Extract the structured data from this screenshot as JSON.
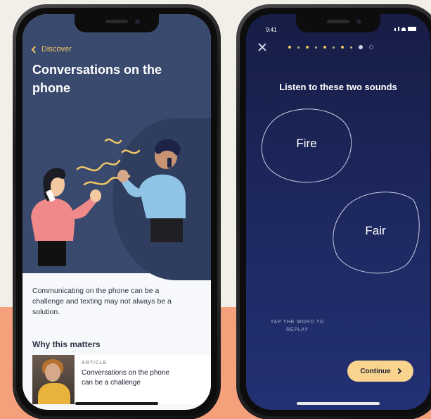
{
  "colors": {
    "accent": "#f2c665",
    "hero_bg": "#3a4a6e",
    "lesson_bg": "#1e2a63",
    "cta": "#f9d48f",
    "backdrop_bottom": "#f4a07a"
  },
  "left_screen": {
    "back_label": "Discover",
    "title": "Conversations on the phone",
    "intro": "Communicating on the phone can be a challenge and texting may not always be a solution.",
    "section_heading": "Why this matters",
    "article": {
      "label": "ARTICLE",
      "title": "Conversations on the phone can be a challenge"
    }
  },
  "right_screen": {
    "status_time": "9:41",
    "prompt": "Listen to these two sounds",
    "words": [
      "Fire",
      "Fair"
    ],
    "hint": "TAP THE WORD TO REPLAY",
    "continue_label": "Continue",
    "progress": {
      "total": 10,
      "current": 9
    },
    "icons": [
      "close-icon",
      "chevron-right-icon",
      "chevron-left-icon",
      "signal-icon",
      "wifi-icon",
      "battery-icon"
    ]
  }
}
